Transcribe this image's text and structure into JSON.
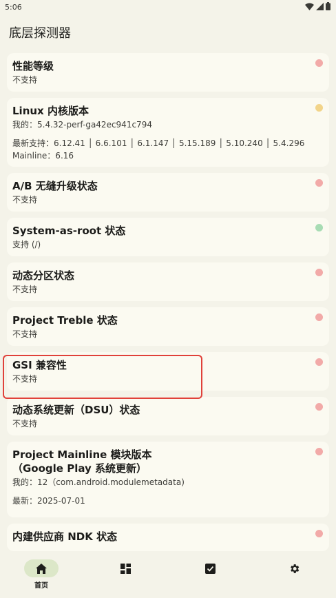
{
  "status_bar": {
    "time": "5:06"
  },
  "app_title": "底层探测器",
  "colors": {
    "red": "#f2aaa8",
    "yellow": "#f2d48a",
    "green": "#a8dcb4"
  },
  "cards": [
    {
      "title": "性能等级",
      "lines": [
        "不支持"
      ],
      "status": "red"
    },
    {
      "title": "Linux 内核版本",
      "lines": [
        "我的：5.4.32-perf-ga42ec941c794"
      ],
      "extra": [
        "最新支持：6.12.41 │ 6.6.101 │ 6.1.147 │ 5.15.189 │ 5.10.240 │ 5.4.296",
        "Mainline：6.16"
      ],
      "status": "yellow"
    },
    {
      "title": "A/B 无缝升级状态",
      "lines": [
        "不支持"
      ],
      "status": "red"
    },
    {
      "title": "System-as-root 状态",
      "lines": [
        "支持 (/)"
      ],
      "status": "green"
    },
    {
      "title": "动态分区状态",
      "lines": [
        "不支持"
      ],
      "status": "red"
    },
    {
      "title": "Project Treble 状态",
      "lines": [
        "不支持"
      ],
      "status": "red"
    },
    {
      "title": "GSI 兼容性",
      "lines": [
        "不支持"
      ],
      "status": "red"
    },
    {
      "title": "动态系统更新（DSU）状态",
      "lines": [
        "不支持"
      ],
      "status": "red"
    },
    {
      "title": "Project Mainline 模块版本\n（Google Play 系统更新）",
      "lines": [
        "我的：12（com.android.modulemetadata)"
      ],
      "extra": [
        "最新：2025-07-01"
      ],
      "status": "red"
    },
    {
      "title": "内建供应商 NDK 状态",
      "lines": [],
      "status": "red"
    }
  ],
  "bottom_nav": [
    {
      "icon": "home-icon",
      "label": "首页",
      "active": true
    },
    {
      "icon": "dashboard-icon",
      "label": "",
      "active": false
    },
    {
      "icon": "checkbox-icon",
      "label": "",
      "active": false
    },
    {
      "icon": "settings-icon",
      "label": "",
      "active": false
    }
  ]
}
